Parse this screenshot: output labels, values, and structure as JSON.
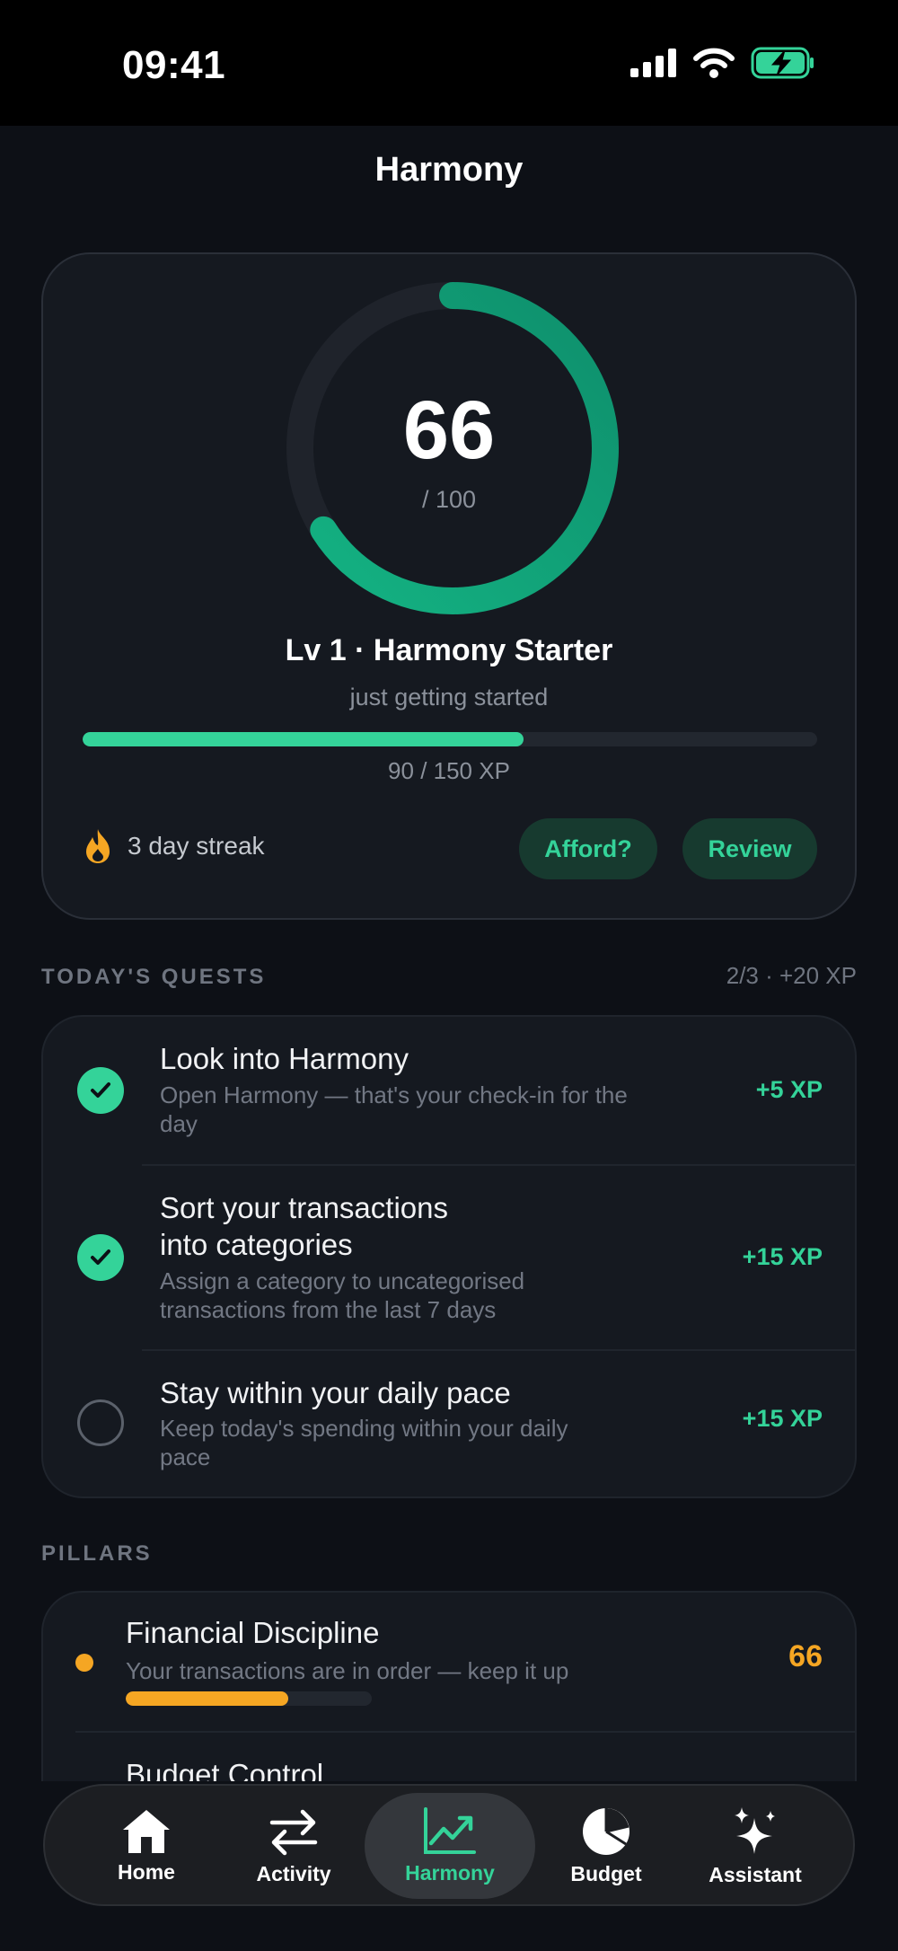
{
  "status_bar": {
    "time": "09:41"
  },
  "header": {
    "title": "Harmony"
  },
  "score": {
    "value": "66",
    "max": "/ 100",
    "fraction": 0.66,
    "level_title": "Lv 1 · Harmony Starter",
    "level_subtitle": "just getting started",
    "xp_text": "90 / 150 XP",
    "xp_fraction": 0.6,
    "streak": "3 day streak",
    "afford_label": "Afford?",
    "review_label": "Review"
  },
  "quests": {
    "heading": "TODAY'S QUESTS",
    "summary": "2/3 · +20 XP",
    "items": [
      {
        "title": "Look into Harmony",
        "description": "Open Harmony — that's your check-in for the day",
        "xp": "+5 XP",
        "done": true
      },
      {
        "title": "Sort your transactions into categories",
        "description": "Assign a category to uncategorised transactions from the last 7 days",
        "xp": "+15 XP",
        "done": true
      },
      {
        "title": "Stay within your daily pace",
        "description": "Keep today's spending within your daily pace",
        "xp": "+15 XP",
        "done": false
      }
    ]
  },
  "pillars": {
    "heading": "PILLARS",
    "items": [
      {
        "title": "Financial Discipline",
        "description": "Your transactions are in order — keep it up",
        "score": "66",
        "fraction": 0.66,
        "color": "#f5a623"
      },
      {
        "title": "Budget Control"
      }
    ]
  },
  "nav": {
    "tabs": [
      {
        "label": "Home",
        "icon": "house-icon",
        "active": false
      },
      {
        "label": "Activity",
        "icon": "arrows-left-right-icon",
        "active": false
      },
      {
        "label": "Harmony",
        "icon": "trend-chart-icon",
        "active": true
      },
      {
        "label": "Budget",
        "icon": "pie-chart-icon",
        "active": false
      },
      {
        "label": "Assistant",
        "icon": "sparkles-icon",
        "active": false
      }
    ]
  },
  "colors": {
    "accent": "#34d399",
    "warning": "#f5a623",
    "background": "#0d1016"
  }
}
